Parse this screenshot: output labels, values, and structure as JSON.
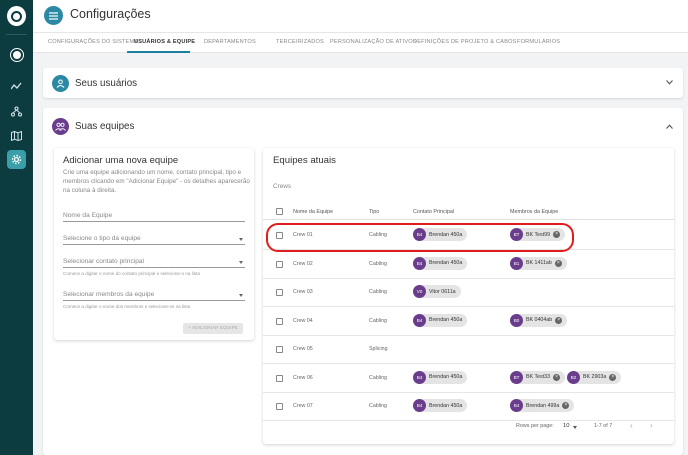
{
  "header": {
    "title": "Configurações"
  },
  "tabs": [
    {
      "label": "CONFIGURAÇÕES DO SISTEMA"
    },
    {
      "label": "USUÁRIOS & EQUIPE"
    },
    {
      "label": "DEPARTAMENTOS"
    },
    {
      "label": "TERCEIRIZADOS"
    },
    {
      "label": "PERSONALIZAÇÃO DE ATIVOS"
    },
    {
      "label": "DEFINIÇÕES DE PROJETO & CABOS"
    },
    {
      "label": "FORMULÁRIOS"
    }
  ],
  "active_tab": "USUÁRIOS & EQUIPE",
  "users_panel": {
    "title": "Seus usuários"
  },
  "teams_panel": {
    "title": "Suas equipes"
  },
  "new_team": {
    "title": "Adicionar uma nova equipe",
    "description": "Crie uma equipe adicionando um nome, contato principal, tipo e membros clicando em \"Adicionar Equipe\" - os detalhes aparecerão na coluna à direita.",
    "name_placeholder": "Nome da Equipe",
    "type_placeholder": "Selecione o tipo da equipe",
    "contact_placeholder": "Selecionar contato principal",
    "contact_hint": "Comece a digitar o nome do contato principal e selecione-o na lista",
    "members_placeholder": "Selecionar membros da equipe",
    "members_hint": "Comece a digitar o nome dos membros e selecione-os na lista",
    "add_button": "+ ADICIONAR EQUIPE"
  },
  "current_teams": {
    "title": "Equipes atuais",
    "subtitle": "Crews",
    "columns": {
      "name": "Nome da Equipe",
      "type": "Tipo",
      "contact": "Contato Principal",
      "members": "Membros da Equipe"
    },
    "rows": [
      {
        "name": "Crew 01",
        "type": "Cabling",
        "contact": {
          "initials": "B4",
          "name": "Brendan 450a"
        },
        "members": [
          {
            "initials": "BT",
            "name": "BK Test99"
          }
        ]
      },
      {
        "name": "Crew 02",
        "type": "Cabling",
        "contact": {
          "initials": "B4",
          "name": "Brendan 450a"
        },
        "members": [
          {
            "initials": "B1",
            "name": "BK 1411ab"
          }
        ]
      },
      {
        "name": "Crew 03",
        "type": "Cabling",
        "contact": {
          "initials": "V0",
          "name": "Vitor 0611a"
        },
        "members": []
      },
      {
        "name": "Crew 04",
        "type": "Cabling",
        "contact": {
          "initials": "B4",
          "name": "Brendan 450a"
        },
        "members": [
          {
            "initials": "B0",
            "name": "BK 0404ab"
          }
        ]
      },
      {
        "name": "Crew 05",
        "type": "Splicing",
        "contact": null,
        "members": []
      },
      {
        "name": "Crew 06",
        "type": "Cabling",
        "contact": {
          "initials": "B4",
          "name": "Brendan 450a"
        },
        "members": [
          {
            "initials": "BT",
            "name": "BK Test33"
          },
          {
            "initials": "B2",
            "name": "BK 2903a"
          }
        ]
      },
      {
        "name": "Crew 07",
        "type": "Cabling",
        "contact": {
          "initials": "B4",
          "name": "Brendan 450a"
        },
        "members": [
          {
            "initials": "B4",
            "name": "Brendan 499a"
          }
        ]
      }
    ],
    "footer": {
      "rows_per_page_label": "Rows per page:",
      "rows_per_page": "10",
      "range": "1-7 of 7"
    }
  },
  "colors": {
    "sidebar": "#0d3c40",
    "accent": "#1e7fa0",
    "avatar": "#6a3c8c",
    "highlight": "#e01c1c"
  }
}
